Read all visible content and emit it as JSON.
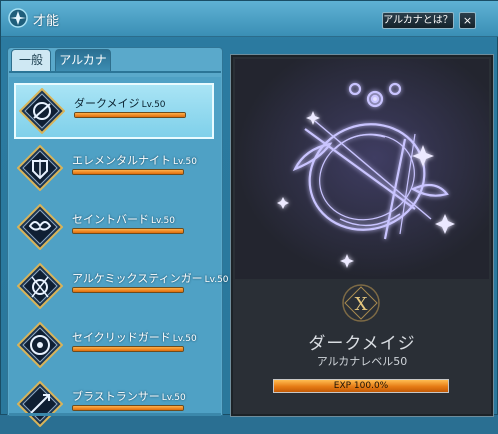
{
  "window": {
    "title": "才能",
    "help_label": "アルカナとは？",
    "close_label": "×"
  },
  "tabs": [
    {
      "label": "一般",
      "active": false
    },
    {
      "label": "アルカナ",
      "active": true
    }
  ],
  "arcana_list": [
    {
      "name": "ダークメイジ",
      "level": "Lv.50",
      "progress": 1.0,
      "selected": true
    },
    {
      "name": "エレメンタルナイト",
      "level": "Lv.50",
      "progress": 1.0,
      "selected": false
    },
    {
      "name": "セイントバード",
      "level": "Lv.50",
      "progress": 1.0,
      "selected": false
    },
    {
      "name": "アルケミックスティンガー",
      "level": "Lv.50",
      "progress": 1.0,
      "selected": false
    },
    {
      "name": "セイクリッドガード",
      "level": "Lv.50",
      "progress": 1.0,
      "selected": false
    },
    {
      "name": "ブラストランサー",
      "level": "Lv.50",
      "progress": 1.0,
      "selected": false
    }
  ],
  "detail": {
    "numeral": "X",
    "name": "ダークメイジ",
    "level_text": "アルカナレベル50",
    "exp_text": "EXP 100.0%",
    "exp_progress": 1.0
  },
  "colors": {
    "window_bg": "#2a789c",
    "list_bg": "#4fa1c5",
    "selected_bg": "#8fd8ee",
    "bar_fill": "#e06d0b",
    "art_glow": "#b7b2ff"
  }
}
